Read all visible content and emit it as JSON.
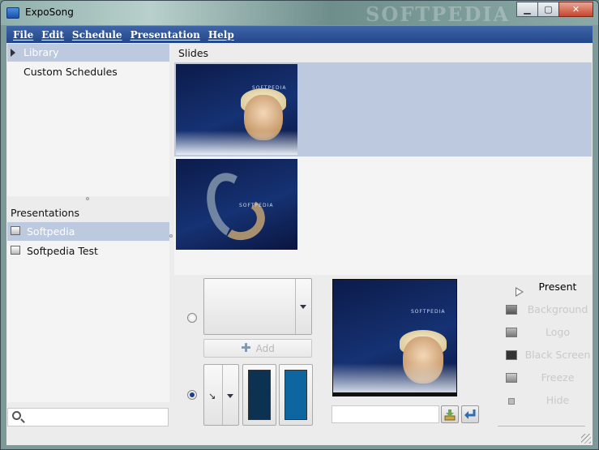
{
  "window": {
    "title": "ExpoSong",
    "watermark": "SOFTPEDIA",
    "minimize_glyph": "▁",
    "maximize_glyph": "▢",
    "close_glyph": "✕"
  },
  "menu": [
    "File",
    "Edit",
    "Schedule",
    "Presentation",
    "Help"
  ],
  "library": {
    "items": [
      {
        "label": "Library",
        "selected": true,
        "expandable": true
      },
      {
        "label": "Custom Schedules",
        "selected": false,
        "expandable": false
      }
    ]
  },
  "presentations": {
    "header": "Presentations",
    "items": [
      {
        "label": "Softpedia",
        "selected": true
      },
      {
        "label": "Softpedia Test",
        "selected": false
      }
    ]
  },
  "search": {
    "value": ""
  },
  "slides": {
    "header": "Slides",
    "items": [
      {
        "selected": true,
        "thumb_text": "SOFTPEDIA"
      },
      {
        "selected": false,
        "thumb_text": "SOFTPEDIA"
      }
    ]
  },
  "background": {
    "add_label": "Add",
    "transition_glyph": "↘",
    "color1": "#0d3150",
    "color2": "#0d66a0"
  },
  "preview": {
    "thumb_text": "SOFTPEDIA",
    "input_value": ""
  },
  "controls": {
    "present": "Present",
    "background": "Background",
    "logo": "Logo",
    "black_screen": "Black Screen",
    "freeze": "Freeze",
    "hide": "Hide"
  }
}
